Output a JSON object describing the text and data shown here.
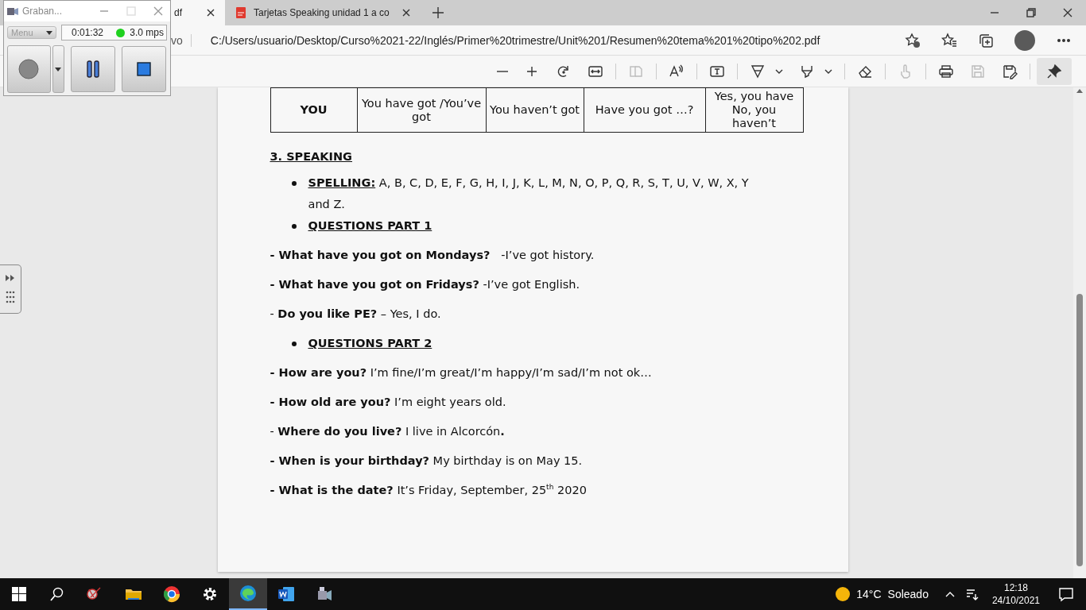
{
  "browser": {
    "tabs": [
      {
        "title": "df",
        "selected": true
      },
      {
        "title": "Tarjetas Speaking unidad 1 a co",
        "selected": false
      }
    ],
    "address": {
      "prefix": "vo",
      "url": "C:/Users/usuario/Desktop/Curso%2021-22/Inglés/Primer%20trimestre/Unit%201/Resumen%20tema%201%20tipo%202.pdf"
    },
    "pdf_toolbar": [
      {
        "disabled": false,
        "selected": false
      },
      {
        "disabled": false,
        "selected": false
      },
      {
        "disabled": false,
        "selected": false
      },
      {
        "disabled": false,
        "selected": false
      },
      {
        "disabled": true,
        "selected": false
      },
      {
        "disabled": false,
        "selected": false
      },
      {
        "disabled": false,
        "selected": false
      },
      {
        "disabled": false,
        "selected": false
      },
      {
        "disabled": false,
        "selected": false
      },
      {
        "disabled": false,
        "selected": false
      },
      {
        "disabled": true,
        "selected": false
      },
      {
        "disabled": false,
        "selected": false
      },
      {
        "disabled": true,
        "selected": false
      },
      {
        "disabled": false,
        "selected": false
      },
      {
        "disabled": false,
        "selected": true
      }
    ]
  },
  "document": {
    "table_row": [
      "YOU",
      "You have got /You’ve got",
      "You haven’t got",
      "Have you got …?",
      "Yes, you have No, you haven’t"
    ],
    "heading": "3. SPEAKING",
    "items": [
      {
        "kind": "bullet",
        "label": "SPELLING:",
        "text": "A, B, C, D, E, F, G, H, I, J, K, L, M, N, O, P, Q, R, S, T, U, V, W, X, Y and Z."
      },
      {
        "kind": "bullet",
        "label": "QUESTIONS PART 1"
      },
      {
        "kind": "line",
        "text": "**- What have you got on Mondays?**   -I’ve got history."
      },
      {
        "kind": "line",
        "text": "**- What have you got on Fridays?** -I’ve got English."
      },
      {
        "kind": "line",
        "text": "- **Do you like PE?** – Yes, I do."
      },
      {
        "kind": "bullet",
        "label": "QUESTIONS PART 2"
      },
      {
        "kind": "line",
        "text": "**- How are you?** I’m fine/I’m great/I’m happy/I’m sad/I’m not ok…"
      },
      {
        "kind": "line",
        "text": "**- How old are you?** I’m eight years old."
      },
      {
        "kind": "line",
        "text": "- **Where do you live?** I live in Alcorcón**.**"
      },
      {
        "kind": "line",
        "text": "**- When is your birthday?** My birthday is on May 15."
      },
      {
        "kind": "line",
        "text": "**- What is the date?** It’s Friday, September, 25$^{th}$ 2020"
      }
    ]
  },
  "recorder": {
    "title": "Graban...",
    "menu": {
      "label": "Menu",
      "disabled": true
    },
    "time": "0:01:32",
    "rate": "3.0 mps"
  },
  "taskbar": {
    "apps": [
      {
        "selected": false
      },
      {
        "selected": false
      },
      {
        "selected": false
      },
      {
        "selected": false
      },
      {
        "selected": true
      },
      {
        "selected": false
      },
      {
        "selected": false
      }
    ],
    "temperature": "14°C",
    "condition": "Soleado",
    "time": "12:18",
    "date": "24/10/2021"
  }
}
